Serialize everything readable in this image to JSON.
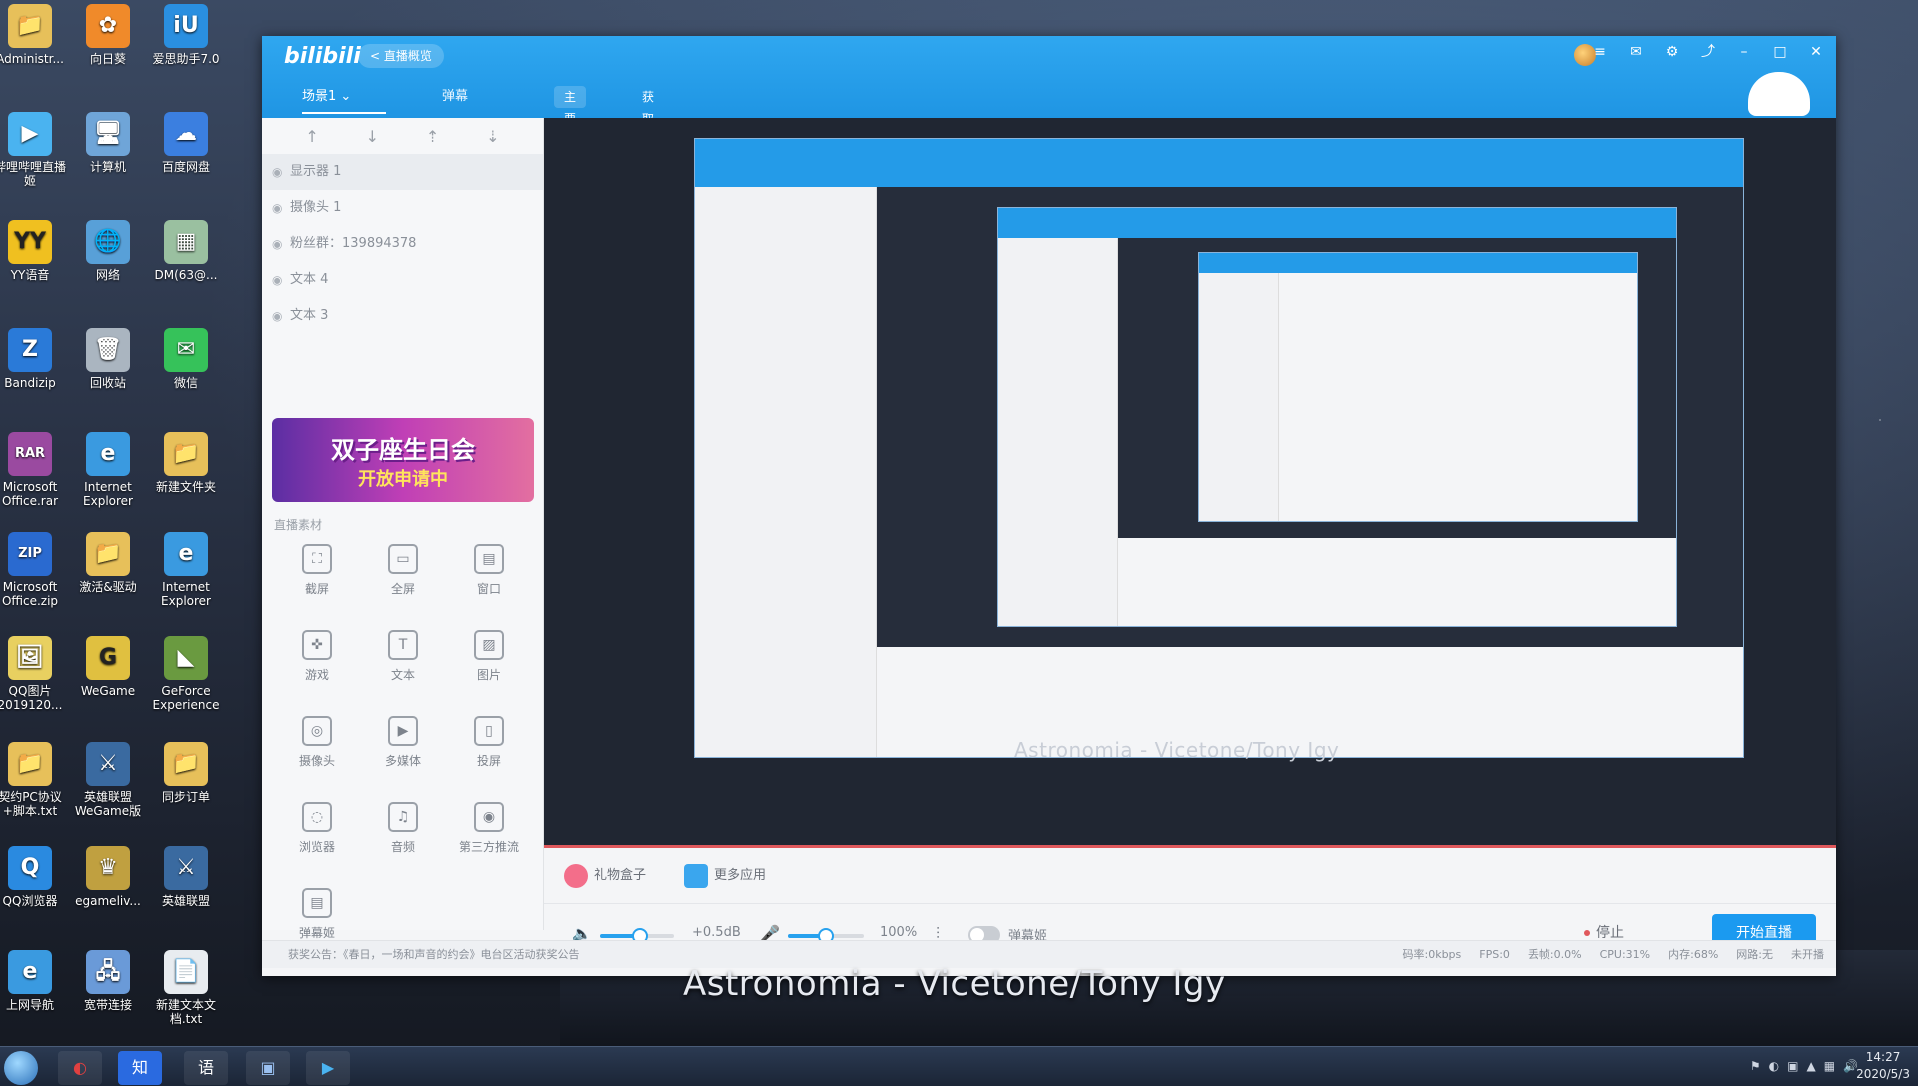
{
  "desktop": {
    "icons": [
      {
        "label": "Administr...",
        "color": "#e7c05a",
        "glyph": "📁"
      },
      {
        "label": "向日葵",
        "color": "#f08a2a",
        "glyph": "✿"
      },
      {
        "label": "爱思助手7.0",
        "color": "#2a8fe0",
        "glyph": "iU"
      },
      {
        "label": "哔哩哔哩直播姬",
        "color": "#4ab3f0",
        "glyph": "▶"
      },
      {
        "label": "计算机",
        "color": "#6fa5d8",
        "glyph": "🖥"
      },
      {
        "label": "百度网盘",
        "color": "#3b7fe0",
        "glyph": "☁"
      },
      {
        "label": "YY语音",
        "color": "#f0c020",
        "glyph": "YY"
      },
      {
        "label": "网络",
        "color": "#58a0d8",
        "glyph": "🌐"
      },
      {
        "label": "DM(63@...",
        "color": "#9ac0a0",
        "glyph": "▦"
      },
      {
        "label": "Bandizip",
        "color": "#2a7ad8",
        "glyph": "Z"
      },
      {
        "label": "回收站",
        "color": "#aab5c0",
        "glyph": "🗑"
      },
      {
        "label": "微信",
        "color": "#36c25a",
        "glyph": "✉"
      },
      {
        "label": "Microsoft Office.rar",
        "color": "#9a4aa0",
        "glyph": "RAR"
      },
      {
        "label": "Internet Explorer",
        "color": "#3a9ae0",
        "glyph": "e"
      },
      {
        "label": "新建文件夹",
        "color": "#e7c05a",
        "glyph": "📁"
      },
      {
        "label": "Microsoft Office.zip",
        "color": "#2a6ad0",
        "glyph": "ZIP"
      },
      {
        "label": "激活&驱动",
        "color": "#e7c05a",
        "glyph": "📁"
      },
      {
        "label": "Internet Explorer",
        "color": "#3a9ae0",
        "glyph": "e"
      },
      {
        "label": "QQ图片 2019120...",
        "color": "#e8d060",
        "glyph": "🖼"
      },
      {
        "label": "WeGame",
        "color": "#e0c040",
        "glyph": "G"
      },
      {
        "label": "GeForce Experience",
        "color": "#6a9a40",
        "glyph": "◣"
      },
      {
        "label": "契约PC协议+脚本.txt",
        "color": "#e7c05a",
        "glyph": "📁"
      },
      {
        "label": "英雄联盟WeGame版",
        "color": "#3a6aa0",
        "glyph": "⚔"
      },
      {
        "label": "同步订单",
        "color": "#e7c05a",
        "glyph": "📁"
      },
      {
        "label": "QQ浏览器",
        "color": "#2a8ae0",
        "glyph": "Q"
      },
      {
        "label": "egameliv...",
        "color": "#c0a040",
        "glyph": "♛"
      },
      {
        "label": "英雄联盟",
        "color": "#3a6aa0",
        "glyph": "⚔"
      },
      {
        "label": "上网导航",
        "color": "#3a9ae0",
        "glyph": "e"
      },
      {
        "label": "宽带连接",
        "color": "#6a9ad8",
        "glyph": "🖧"
      },
      {
        "label": "新建文本文档.txt",
        "color": "#e8ecf0",
        "glyph": "📄"
      }
    ]
  },
  "app": {
    "logo": "bilibili",
    "back_label": "< 直播概览",
    "tabs": {
      "scene": "场景1 ⌄",
      "danmaku": "弹幕",
      "pill1": "主要步骤",
      "pill2": "获取分区数据冲冲冲"
    },
    "sources": [
      {
        "label": "显示器 1"
      },
      {
        "label": "摄像头 1"
      },
      {
        "label": "粉丝群：139894378"
      },
      {
        "label": "文本 4"
      },
      {
        "label": "文本 3"
      }
    ],
    "banner": {
      "line1": "双子座生日会",
      "line2": "开放申请中"
    },
    "materials_title": "直播素材",
    "materials": [
      {
        "label": "截屏",
        "icon": "crop-icon",
        "glyph": "⛶"
      },
      {
        "label": "全屏",
        "icon": "monitor-icon",
        "glyph": "▭"
      },
      {
        "label": "窗口",
        "icon": "window-icon",
        "glyph": "▤"
      },
      {
        "label": "游戏",
        "icon": "gamepad-icon",
        "glyph": "✜"
      },
      {
        "label": "文本",
        "icon": "text-icon",
        "glyph": "T"
      },
      {
        "label": "图片",
        "icon": "image-icon",
        "glyph": "▨"
      },
      {
        "label": "摄像头",
        "icon": "camera-icon",
        "glyph": "◎"
      },
      {
        "label": "多媒体",
        "icon": "media-icon",
        "glyph": "▶"
      },
      {
        "label": "投屏",
        "icon": "cast-icon",
        "glyph": "▯"
      },
      {
        "label": "浏览器",
        "icon": "browser-icon",
        "glyph": "◌"
      },
      {
        "label": "音频",
        "icon": "music-icon",
        "glyph": "♫"
      },
      {
        "label": "第三方推流",
        "icon": "stream-icon",
        "glyph": "◉"
      },
      {
        "label": "弹幕姬",
        "icon": "danmaku-icon",
        "glyph": "▤"
      }
    ],
    "bottom_apps": {
      "gift": "礼物盒子",
      "more": "更多应用"
    },
    "controls": {
      "speaker_value": "+0.5dB",
      "mic_value": "100%",
      "danmaku_toggle": "弹幕姬",
      "stop_label": "停止",
      "start_label": "开始直播"
    },
    "status": {
      "notice": "获奖公告：《春日，一场和声音的约会》电台区活动获奖公告",
      "bitrate": "码率:0kbps",
      "fps": "FPS:0",
      "drop": "丢帧:0.0%",
      "cpu": "CPU:31%",
      "mem": "内存:68%",
      "net": "网路:无",
      "live": "未开播"
    },
    "preview_caption": "Astronomia - Vicetone/Tony Igy"
  },
  "overlay_caption": "Astronomia - Vicetone/Tony Igy",
  "taskbar": {
    "items": [
      {
        "glyph": "◐",
        "color": "#e04040"
      },
      {
        "glyph": "知",
        "color": "#2a6ae0"
      },
      {
        "glyph": "语",
        "color": "#3a8ad0"
      },
      {
        "glyph": "▣",
        "color": "#6a8ad8"
      },
      {
        "glyph": "▶",
        "color": "#4ab3f0"
      }
    ],
    "time": "14:27",
    "date": "2020/5/3"
  },
  "colors": {
    "accent": "#1f95e3",
    "start_button": "#1b9af0",
    "stop_dot": "#e0585c"
  }
}
